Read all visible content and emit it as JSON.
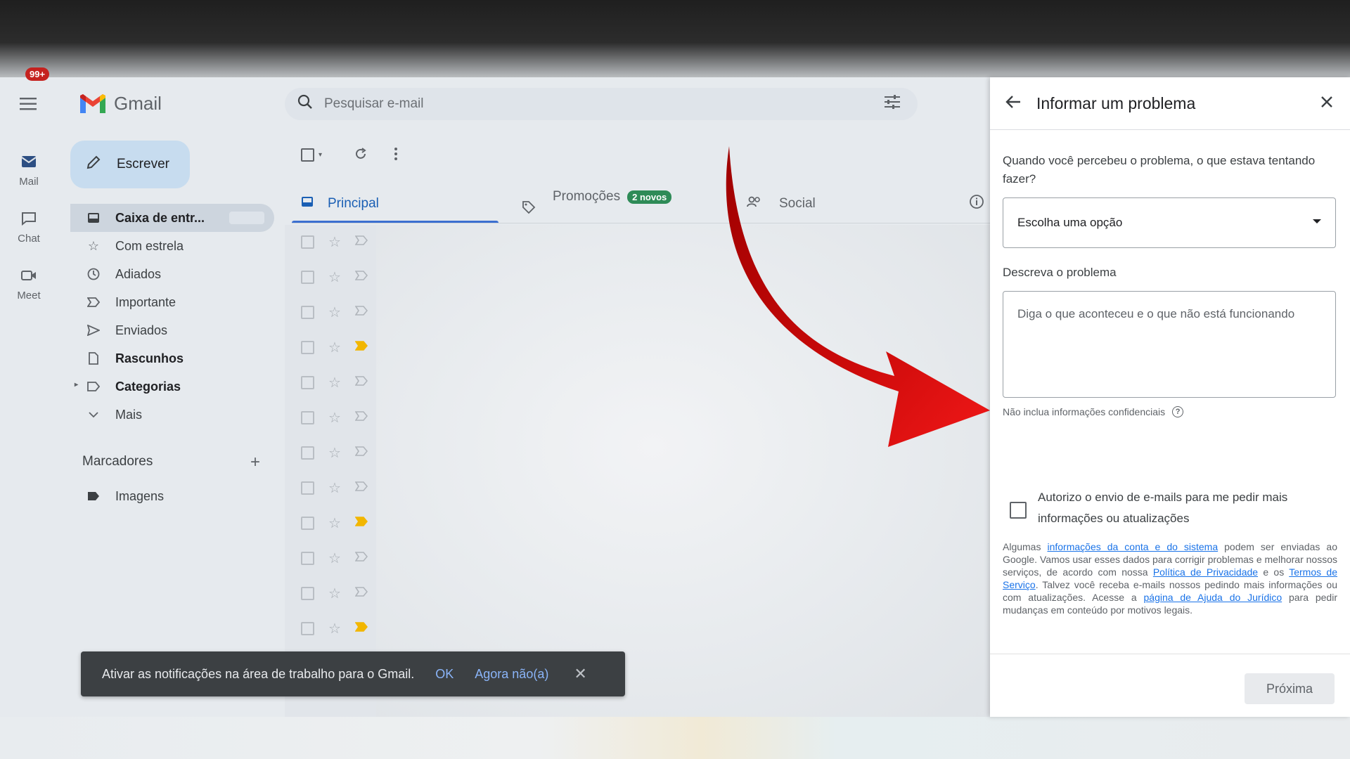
{
  "app": {
    "name": "Gmail"
  },
  "rail": {
    "mail_badge": "99+",
    "items": [
      {
        "label": "Mail",
        "icon": "mail-icon"
      },
      {
        "label": "Chat",
        "icon": "chat-icon"
      },
      {
        "label": "Meet",
        "icon": "meet-icon"
      }
    ]
  },
  "compose": {
    "label": "Escrever"
  },
  "nav": {
    "items": [
      {
        "label": "Caixa de entr...",
        "icon": "inbox-icon"
      },
      {
        "label": "Com estrela",
        "icon": "star-icon"
      },
      {
        "label": "Adiados",
        "icon": "clock-icon"
      },
      {
        "label": "Importante",
        "icon": "important-icon"
      },
      {
        "label": "Enviados",
        "icon": "send-icon"
      },
      {
        "label": "Rascunhos",
        "icon": "draft-icon"
      },
      {
        "label": "Categorias",
        "icon": "label-icon"
      },
      {
        "label": "Mais",
        "icon": "chevron-down-icon"
      }
    ],
    "labels_heading": "Marcadores",
    "labels": [
      {
        "label": "Imagens",
        "icon": "label-icon"
      }
    ]
  },
  "search": {
    "placeholder": "Pesquisar e-mail"
  },
  "tabs": [
    {
      "label": "Principal"
    },
    {
      "label": "Promoções",
      "badge": "2 novos"
    },
    {
      "label": "Social"
    }
  ],
  "snackbar": {
    "message": "Ativar as notificações na área de trabalho para o Gmail.",
    "ok": "OK",
    "not_now": "Agora não(a)"
  },
  "panel": {
    "title": "Informar um problema",
    "question": "Quando você percebeu o problema, o que estava tentando fazer?",
    "select_value": "Escolha uma opção",
    "describe_label": "Descreva o problema",
    "describe_placeholder": "Diga o que aconteceu e o que não está funcionando",
    "hint": "Não inclua informações confidenciais",
    "consent": "Autorizo o envio de e-mails para me pedir mais informações ou atualizações",
    "legal": {
      "t1": "Algumas ",
      "l1": "informações da conta e do sistema",
      "t2": " podem ser enviadas ao Google. Vamos usar esses dados para corrigir problemas e melhorar nossos serviços, de acordo com nossa ",
      "l2": "Política de Privacidade",
      "t3": " e os ",
      "l3": "Termos de Serviço",
      "t4": ". Talvez você receba e-mails nossos pedindo mais informações ou com atualizações. Acesse a ",
      "l4": "página de Ajuda do Jurídico",
      "t5": " para pedir mudanças em conteúdo por motivos legais."
    },
    "next_label": "Próxima"
  },
  "colors": {
    "arrow": "#e01010",
    "accent": "#1a73e8",
    "badge": "#c5221f"
  }
}
